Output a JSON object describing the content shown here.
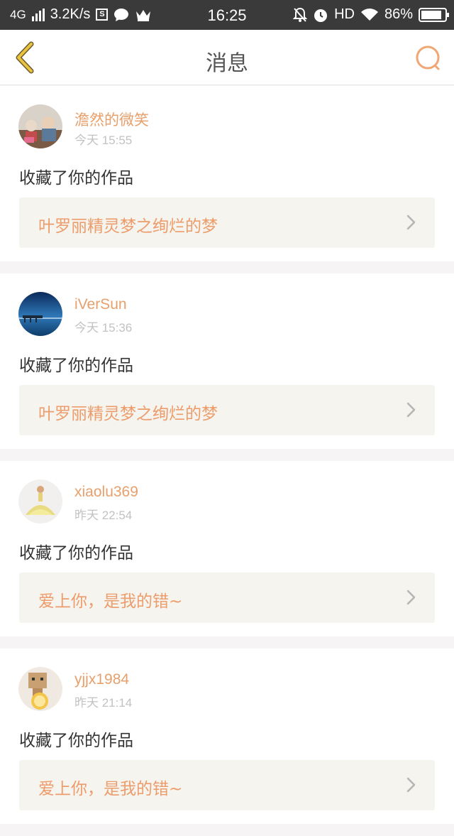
{
  "status_bar": {
    "network": "4G",
    "speed": "3.2K/s",
    "sim_icon_text": "S",
    "time": "16:25",
    "hd": "HD",
    "battery": "86%",
    "battery_level": 0.86
  },
  "header": {
    "title": "消息",
    "back_icon": "chevron-left-icon",
    "search_icon": "search-icon"
  },
  "colors": {
    "accent": "#e7a06b",
    "work_text": "#ed9c6c",
    "work_bg": "#f5f4ee",
    "back_icon": "#e8c340"
  },
  "messages": [
    {
      "username": "澹然的微笑",
      "time": "今天 15:55",
      "action": "收藏了你的作品",
      "work_title": "叶罗丽精灵梦之绚烂的梦"
    },
    {
      "username": "iVerSun",
      "time": "今天 15:36",
      "action": "收藏了你的作品",
      "work_title": "叶罗丽精灵梦之绚烂的梦"
    },
    {
      "username": "xiaolu369",
      "time": "昨天 22:54",
      "action": "收藏了你的作品",
      "work_title": "爱上你，是我的错~"
    },
    {
      "username": "yjjx1984",
      "time": "昨天 21:14",
      "action": "收藏了你的作品",
      "work_title": "爱上你，是我的错~"
    }
  ]
}
